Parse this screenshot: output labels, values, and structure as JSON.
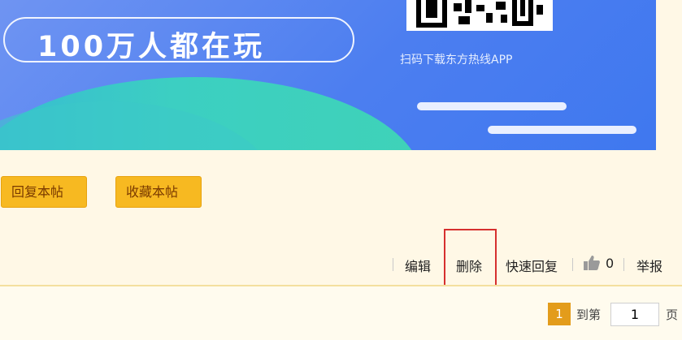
{
  "banner": {
    "slogan": "100万人都在玩",
    "scan_text": "扫码下载东方热线APP"
  },
  "buttons": {
    "reply": "回复本帖",
    "favorite": "收藏本帖"
  },
  "post_actions": {
    "edit": "编辑",
    "delete": "删除",
    "quick_reply": "快速回复",
    "like_count": "0",
    "report": "举报"
  },
  "pager": {
    "current": "1",
    "goto_label": "到第",
    "input_value": "1",
    "unit": "页"
  },
  "colors": {
    "button_bg": "#f7b921",
    "highlight_box": "#d6302f",
    "page_current_bg": "#e39c1b"
  }
}
